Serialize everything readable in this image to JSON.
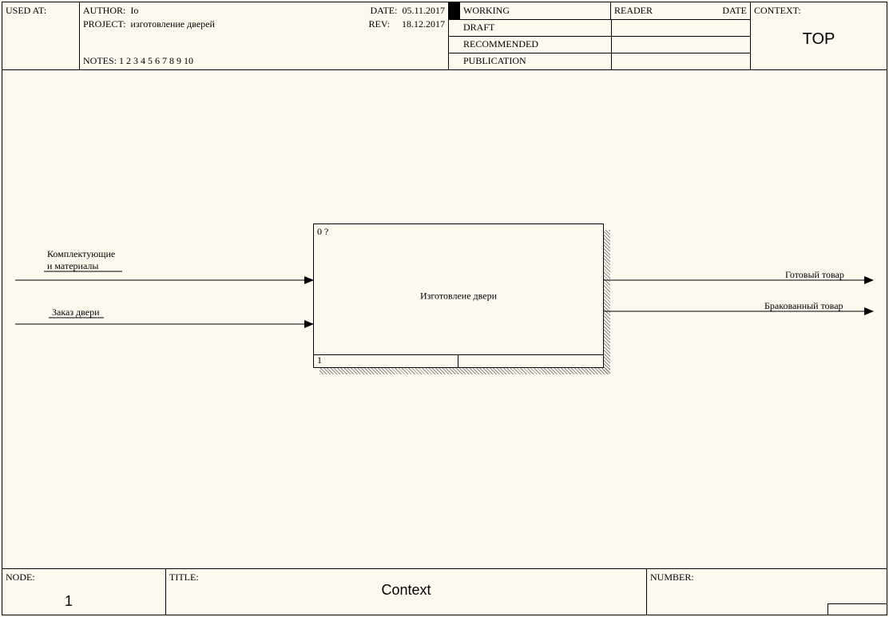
{
  "header": {
    "used_at_label": "USED AT:",
    "author_label": "AUTHOR:",
    "author_value": "Io",
    "project_label": "PROJECT:",
    "project_value": "изготовление дверей",
    "date_label": "DATE:",
    "date_value": "05.11.2017",
    "rev_label": "REV:",
    "rev_value": "18.12.2017",
    "notes_label": "NOTES:",
    "notes_value": "1 2 3 4 5 6 7 8 9 10",
    "status": {
      "working": "WORKING",
      "draft": "DRAFT",
      "recommended": "RECOMMENDED",
      "publication": "PUBLICATION",
      "reader": "READER",
      "reader_date": "DATE"
    },
    "context_label": "CONTEXT:",
    "context_value": "TOP"
  },
  "diagram": {
    "box_top_id": "0 ?",
    "box_title": "Изготовлеие двери",
    "box_bottom_num": "1",
    "inputs": [
      "Комплектующие\nи материалы",
      "Заказ двери"
    ],
    "outputs": [
      "Готовый товар",
      "Бракованный товар"
    ]
  },
  "footer": {
    "node_label": "NODE:",
    "node_value": "1",
    "title_label": "TITLE:",
    "title_value": "Context",
    "number_label": "NUMBER:"
  }
}
